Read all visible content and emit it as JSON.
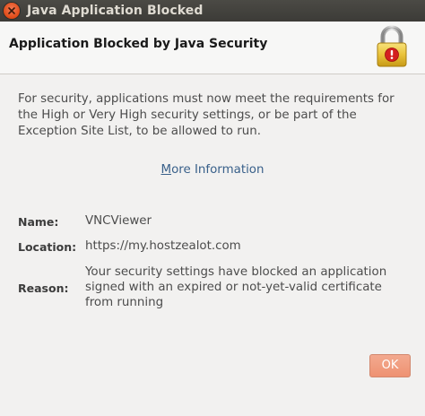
{
  "window": {
    "title": "Java Application Blocked"
  },
  "header": {
    "title": "Application Blocked by Java Security",
    "icon": "padlock-warning-icon"
  },
  "message": "For security, applications must now meet the requirements for the High or Very High security settings, or be part of the Exception Site List, to be allowed to run.",
  "more_info": {
    "underlined": "M",
    "rest": "ore Information"
  },
  "details": {
    "name_label": "Name:",
    "name_value": "VNCViewer",
    "location_label": "Location:",
    "location_value": "https://my.hostzealot.com",
    "reason_label": "Reason:",
    "reason_value": "Your security settings have blocked an application signed with an expired or not-yet-valid certificate from running"
  },
  "buttons": {
    "ok_label": "OK"
  },
  "colors": {
    "accent_ok": "#ee9272",
    "link": "#39608a",
    "titlebar": "#3c3b37",
    "close": "#df4a16"
  }
}
